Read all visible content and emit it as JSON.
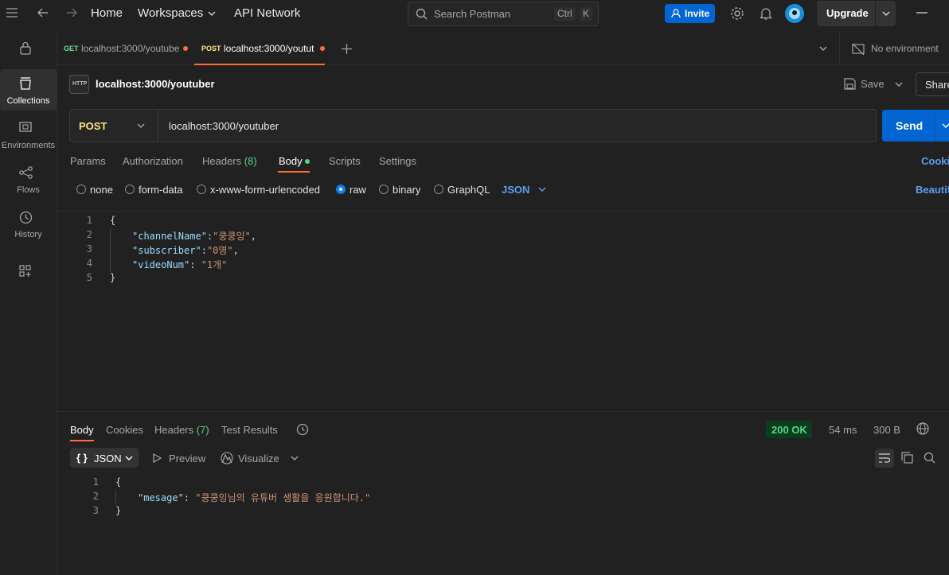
{
  "nav": {
    "home": "Home",
    "workspaces": "Workspaces",
    "api_network": "API Network"
  },
  "search": {
    "placeholder": "Search Postman",
    "key1": "Ctrl",
    "key2": "K"
  },
  "header_actions": {
    "invite": "Invite",
    "upgrade": "Upgrade"
  },
  "sidebar": {
    "items": [
      {
        "label": "Collections",
        "icon": "collections-icon"
      },
      {
        "label": "Environments",
        "icon": "environments-icon"
      },
      {
        "label": "Flows",
        "icon": "flows-icon"
      },
      {
        "label": "History",
        "icon": "history-icon"
      }
    ]
  },
  "tabs": [
    {
      "method": "GET",
      "title": "localhost:3000/youtube",
      "method_color": "#6bdd9a"
    },
    {
      "method": "POST",
      "title": "localhost:3000/youtut",
      "method_color": "#ffe47e"
    }
  ],
  "environment": "No environment",
  "request": {
    "title": "localhost:3000/youtuber",
    "save": "Save",
    "share": "Share",
    "method": "POST",
    "url": "localhost:3000/youtuber",
    "send": "Send"
  },
  "request_tabs": {
    "params": "Params",
    "authorization": "Authorization",
    "headers": "Headers",
    "headers_count": "(8)",
    "body": "Body",
    "scripts": "Scripts",
    "settings": "Settings",
    "cookies": "Cookies"
  },
  "body_types": {
    "none": "none",
    "form_data": "form-data",
    "urlencoded": "x-www-form-urlencoded",
    "raw": "raw",
    "binary": "binary",
    "graphql": "GraphQL",
    "format": "JSON",
    "beautify": "Beautify"
  },
  "request_body": {
    "lines": [
      "1",
      "2",
      "3",
      "4",
      "5"
    ],
    "open": "{",
    "close": "}",
    "k1": "\"channelName\"",
    "v1": "\"쿵쿵잉\"",
    "k2": "\"subscriber\"",
    "v2": "\"0명\"",
    "k3": "\"videoNum\"",
    "v3": "\"1개\""
  },
  "response_tabs": {
    "body": "Body",
    "cookies": "Cookies",
    "headers": "Headers",
    "headers_count": "(7)",
    "test_results": "Test Results"
  },
  "response_meta": {
    "status": "200 OK",
    "time": "54 ms",
    "size": "300 B"
  },
  "response_view": {
    "format": "JSON",
    "format_braces": "{ }",
    "preview": "Preview",
    "visualize": "Visualize"
  },
  "response_body": {
    "lines": [
      "1",
      "2",
      "3"
    ],
    "open": "{",
    "close": "}",
    "k1": "\"mesage\"",
    "v1": "\"쿵쿵잉님의 유튜버 생활을 응원합니다.\""
  }
}
